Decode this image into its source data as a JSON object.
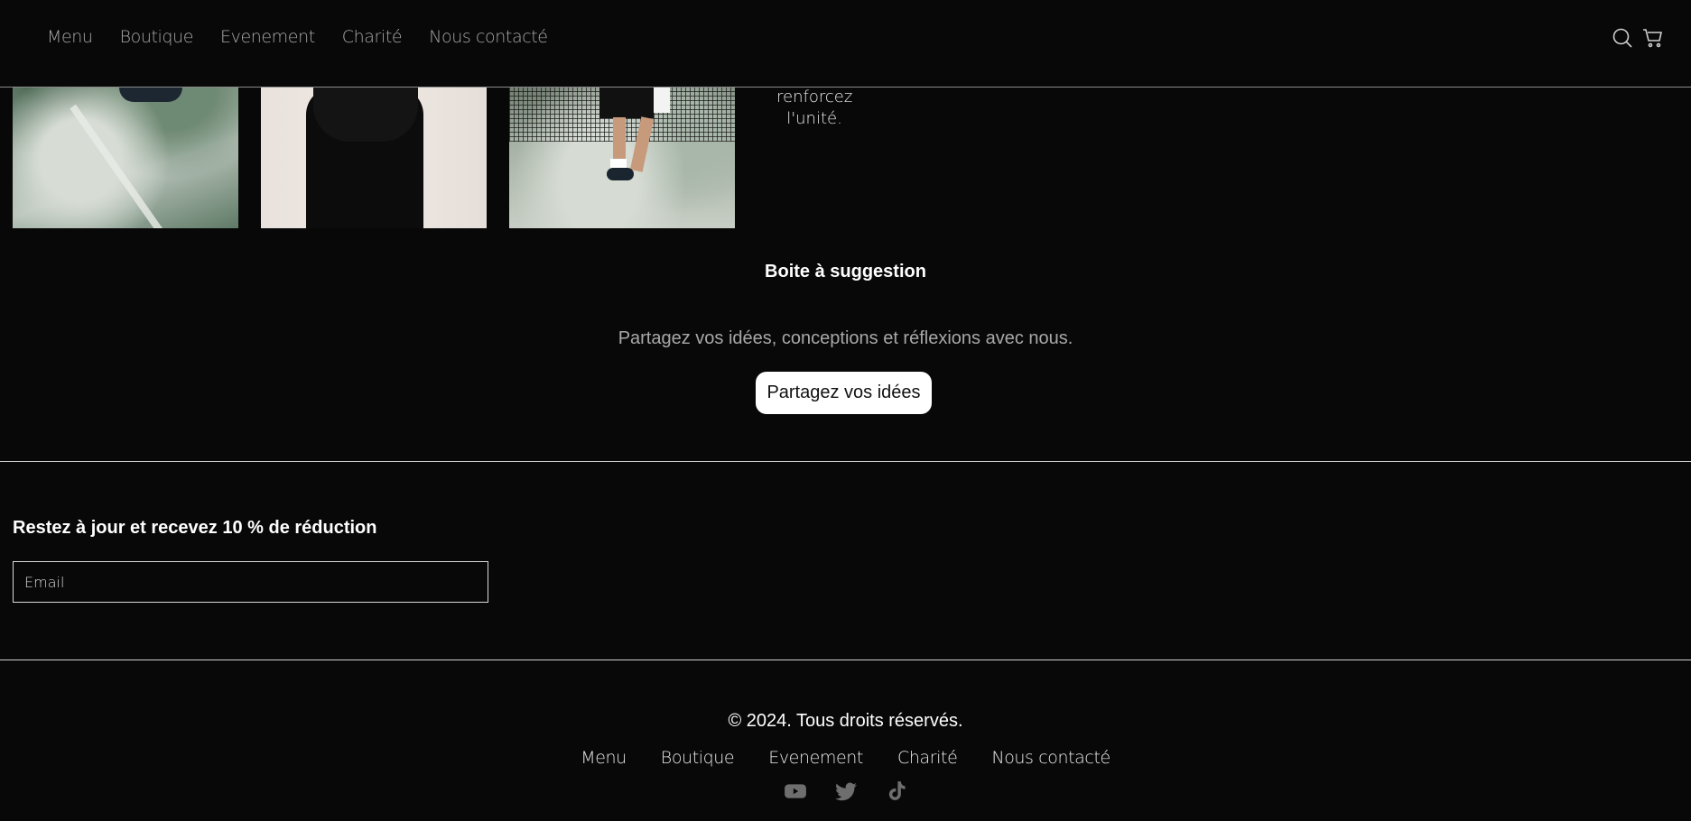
{
  "header": {
    "nav": [
      "Menu",
      "Boutique",
      "Evenement",
      "Charité",
      "Nous contacté"
    ],
    "icons": [
      "search-icon",
      "cart-icon"
    ]
  },
  "gallery": {
    "caption": "renforcez l'unité."
  },
  "suggestion": {
    "title": "Boite à suggestion",
    "text": "Partagez vos idées, conceptions et réflexions avec nous.",
    "button_label": "Partagez vos idées"
  },
  "newsletter": {
    "title": "Restez à jour et recevez 10 % de réduction",
    "email_placeholder": "Email"
  },
  "footer": {
    "copyright": "© 2024. Tous droits réservés.",
    "nav": [
      "Menu",
      "Boutique",
      "Evenement",
      "Charité",
      "Nous contacté"
    ],
    "socials": [
      "youtube-icon",
      "twitter-icon",
      "tiktok-icon"
    ]
  },
  "colors": {
    "background": "#080808",
    "nav_text": "#a8a8a8",
    "social_icon": "#6e6e6e",
    "button_bg": "#ffffff"
  }
}
